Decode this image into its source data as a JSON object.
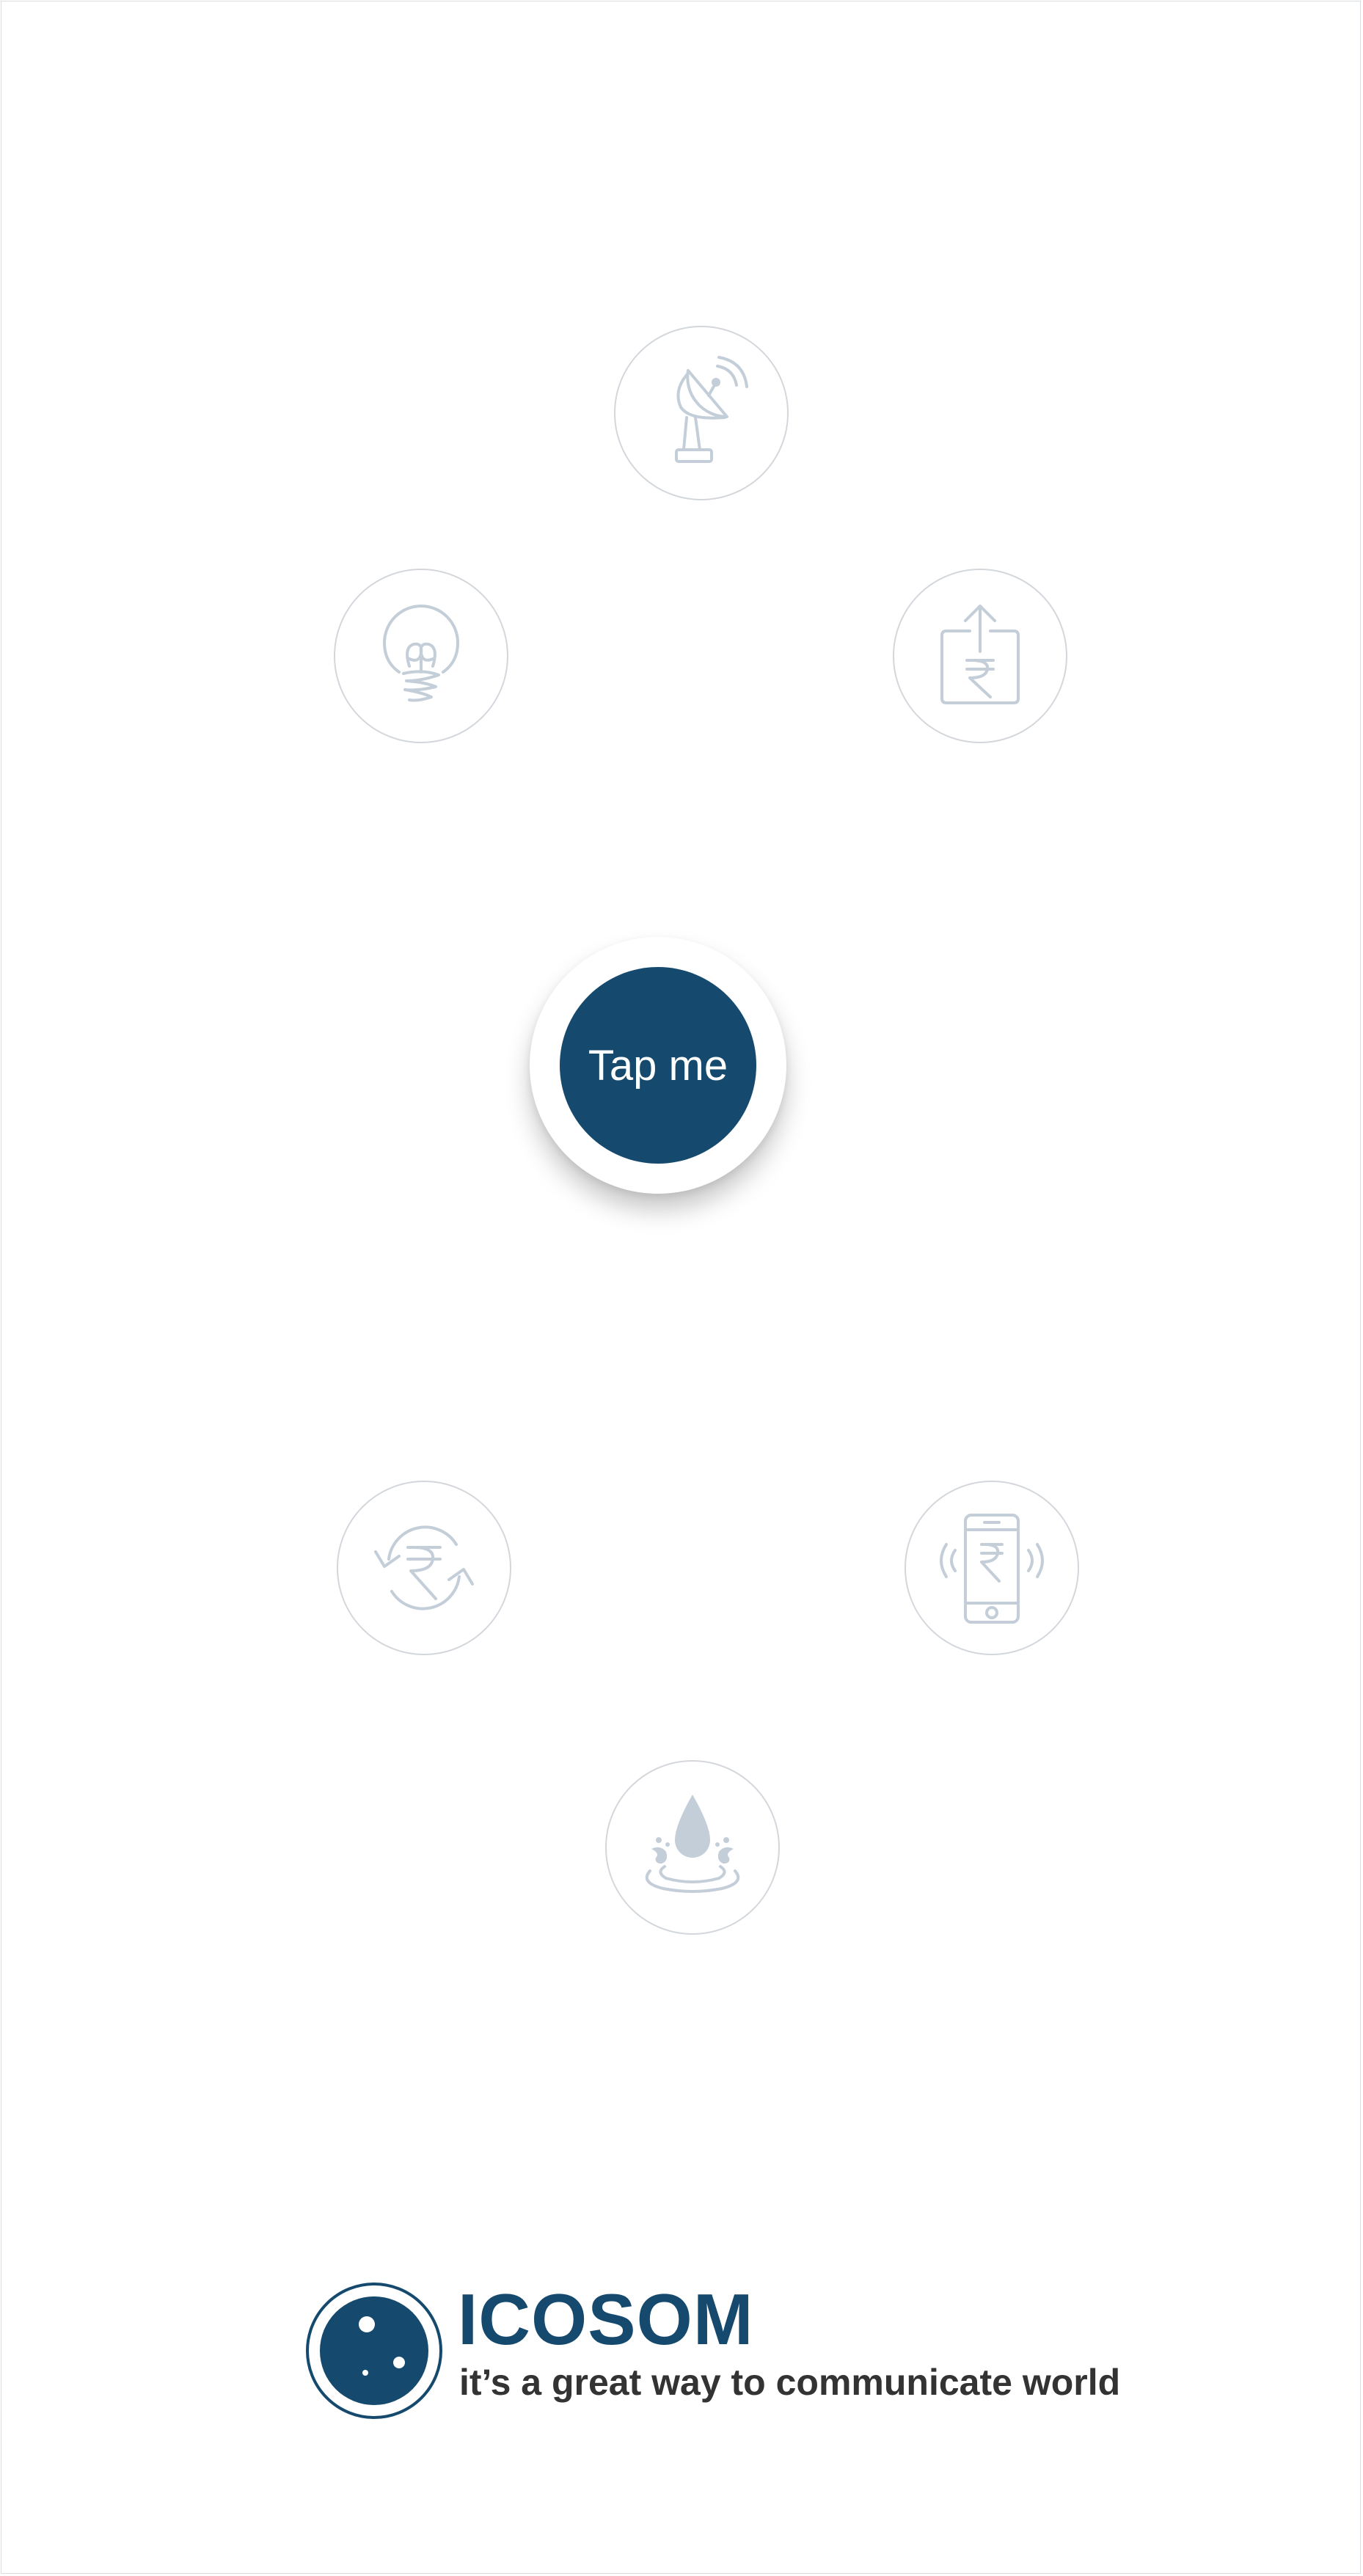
{
  "tap_button": {
    "label": "Tap me",
    "color": "#154a6e"
  },
  "services": [
    {
      "icon": "satellite-dish-icon"
    },
    {
      "icon": "lightbulb-icon"
    },
    {
      "icon": "rupee-upload-icon"
    },
    {
      "icon": "rupee-exchange-icon"
    },
    {
      "icon": "mobile-rupee-icon"
    },
    {
      "icon": "water-drop-icon"
    }
  ],
  "brand": {
    "name": "ICOSOM",
    "tagline": "it’s a great way to communicate world",
    "color": "#154a6e",
    "tagline_color": "#333333"
  },
  "icon_color": "#c3ced8"
}
